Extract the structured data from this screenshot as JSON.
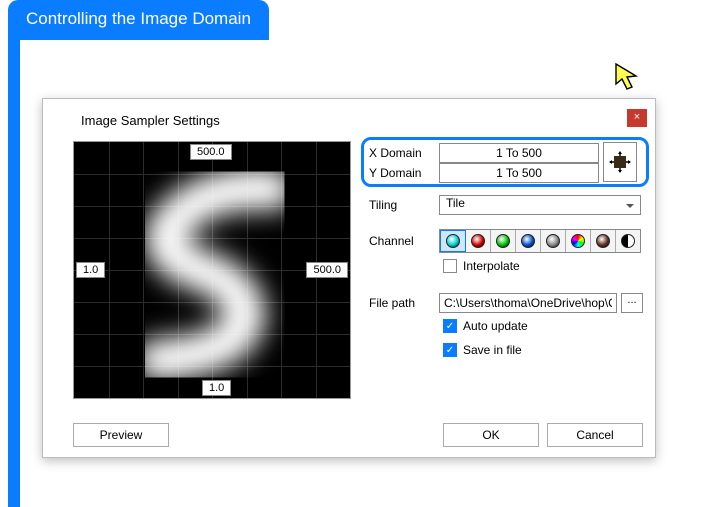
{
  "banner": {
    "title": "Controlling the Image Domain"
  },
  "dialog": {
    "title": "Image Sampler Settings",
    "close": "×",
    "x_domain": {
      "label": "X Domain",
      "value": "1 To 500"
    },
    "y_domain": {
      "label": "Y Domain",
      "value": "1 To 500"
    },
    "tiling": {
      "label": "Tiling",
      "value": "Tile"
    },
    "channel": {
      "label": "Channel"
    },
    "interpolate": {
      "label": "Interpolate",
      "checked": false
    },
    "file_path": {
      "label": "File path",
      "value": "C:\\Users\\thoma\\OneDrive\\hop\\C",
      "browse": "..."
    },
    "auto_update": {
      "label": "Auto update",
      "checked": true
    },
    "save_in_file": {
      "label": "Save in file",
      "checked": true
    },
    "axis": {
      "x_min": "1.0",
      "x_max": "500.0",
      "y_min": "1.0",
      "y_max": "500.0"
    },
    "buttons": {
      "preview": "Preview",
      "ok": "OK",
      "cancel": "Cancel"
    }
  },
  "channel_colors": [
    "#00d0d0",
    "#d00000",
    "#00c000",
    "#0050d0",
    "#888888",
    "conic",
    "#603020",
    "half"
  ]
}
